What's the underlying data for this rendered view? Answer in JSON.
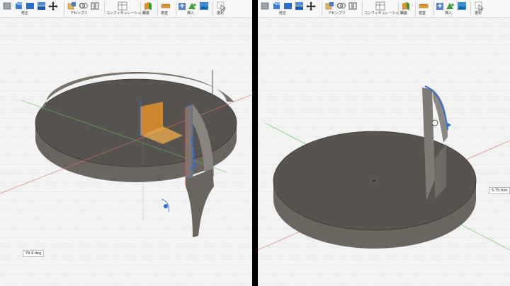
{
  "toolbar": {
    "modify_label": "修正",
    "assemble_label": "アセンブリ",
    "configure_label": "コンフィギュレーション",
    "construct_label": "構築",
    "inspect_label": "検査",
    "insert_label": "挿入",
    "select_label": "選択"
  },
  "left_view": {
    "angle_readout": "79.9 deg"
  },
  "right_view": {
    "distance_readout": "5.75 mm"
  },
  "colors": {
    "body_top": "#565252",
    "body_side": "#6e6964",
    "plane_orange": "#e0922a",
    "axis_blue": "#2f6fd8",
    "edge_highlight": "#4a8af0"
  }
}
